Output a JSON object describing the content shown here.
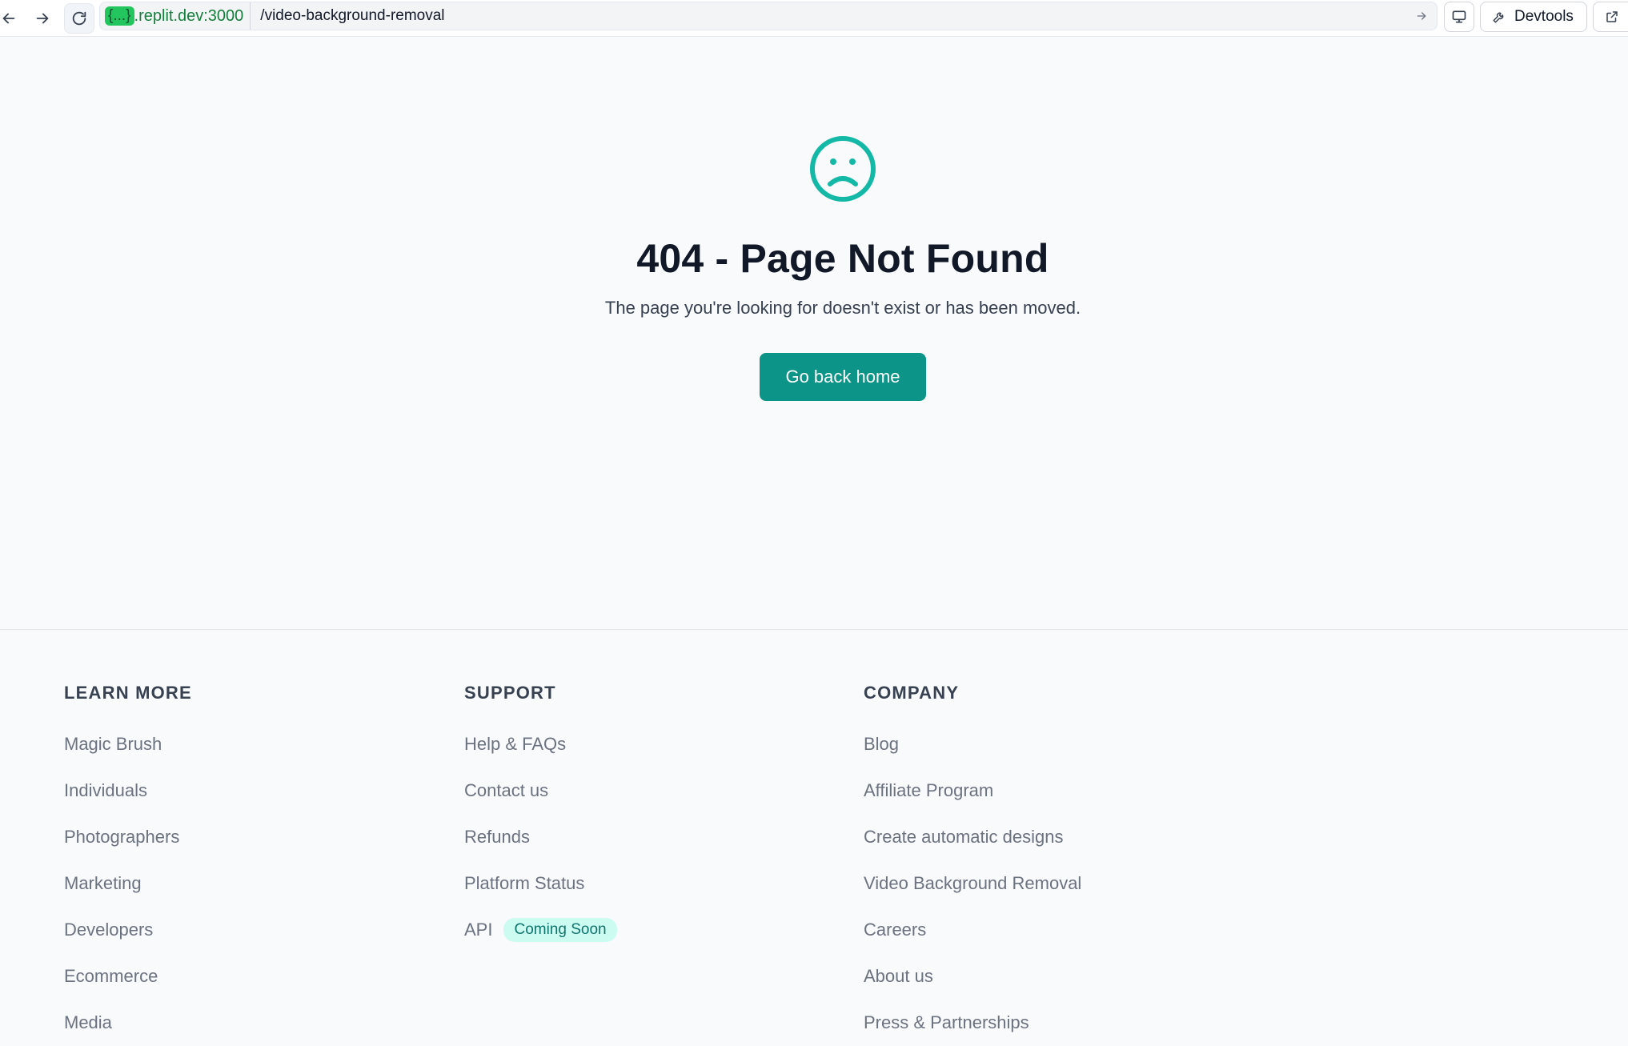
{
  "browser": {
    "url_host_tag": "{...}",
    "url_host": ".replit.dev:3000",
    "url_path": "/video-background-removal",
    "devtools_label": "Devtools",
    "icons": {
      "back": "arrow-left-icon",
      "forward": "arrow-right-icon",
      "reload": "reload-icon",
      "go": "arrow-right-icon",
      "device": "monitor-icon",
      "devtools": "wrench-icon",
      "new_tab": "external-link-icon"
    }
  },
  "error_page": {
    "icon": "sad-face-icon",
    "title": "404 - Page Not Found",
    "message": "The page you're looking for doesn't exist or has been moved.",
    "button_label": "Go back home"
  },
  "footer": {
    "learn_more": {
      "heading": "LEARN MORE",
      "items": [
        "Magic Brush",
        "Individuals",
        "Photographers",
        "Marketing",
        "Developers",
        "Ecommerce",
        "Media"
      ]
    },
    "support": {
      "heading": "SUPPORT",
      "items": [
        "Help & FAQs",
        "Contact us",
        "Refunds",
        "Platform Status",
        "API"
      ],
      "api_badge": "Coming Soon"
    },
    "company": {
      "heading": "COMPANY",
      "items": [
        "Blog",
        "Affiliate Program",
        "Create automatic designs",
        "Video Background Removal",
        "Careers",
        "About us",
        "Press & Partnerships"
      ]
    }
  },
  "colors": {
    "accent": "#0d9488",
    "icon_teal": "#14b8a6",
    "badge_bg": "#ccfbf1",
    "badge_text": "#0f766e",
    "page_bg": "#f8fafc"
  }
}
